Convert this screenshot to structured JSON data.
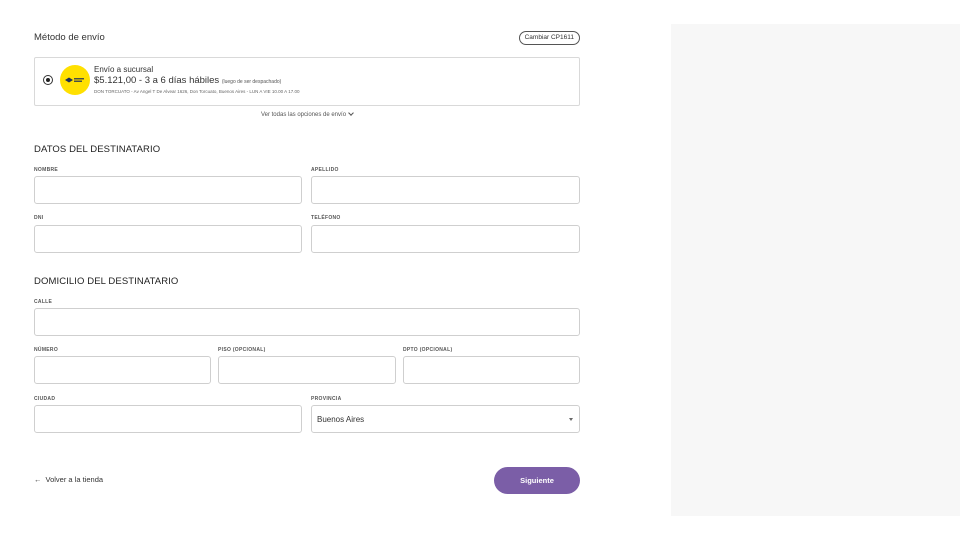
{
  "shipping": {
    "title": "Método de envío",
    "change_cp_label": "Cambiar CP1611",
    "option": {
      "name": "Envío a sucursal",
      "price_line": "$5.121,00 - 3 a 6 días hábiles",
      "note": "(luego de ser despachado)",
      "address": "DON TORCUATO - Av Angel T De Alvear 1626, Don Torcuato, Buenos Aires - LUN A VIE 10.00 A 17.00",
      "selected": true
    },
    "all_options_label": "Ver todas las opciones de envío"
  },
  "recipient": {
    "title": "DATOS DEL DESTINATARIO",
    "nombre_label": "NOMBRE",
    "apellido_label": "APELLIDO",
    "dni_label": "DNI",
    "telefono_label": "TELÉFONO",
    "nombre_value": "",
    "apellido_value": "",
    "dni_value": "",
    "telefono_value": ""
  },
  "address": {
    "title": "DOMICILIO DEL DESTINATARIO",
    "calle_label": "CALLE",
    "numero_label": "NÚMERO",
    "piso_label": "PISO (OPCIONAL)",
    "dpto_label": "DPTO (OPCIONAL)",
    "ciudad_label": "CIUDAD",
    "provincia_label": "PROVINCIA",
    "provincia_value": "Buenos Aires"
  },
  "footer": {
    "back_label": "Volver a la tienda",
    "next_label": "Siguiente"
  },
  "colors": {
    "accent": "#7b5ea7",
    "carrier_logo": "#ffe000",
    "side_panel": "#f7f7f7"
  },
  "icons": {
    "back": "arrow-left-icon",
    "dropdown": "caret-down-icon",
    "expand": "chevron-down-icon"
  }
}
